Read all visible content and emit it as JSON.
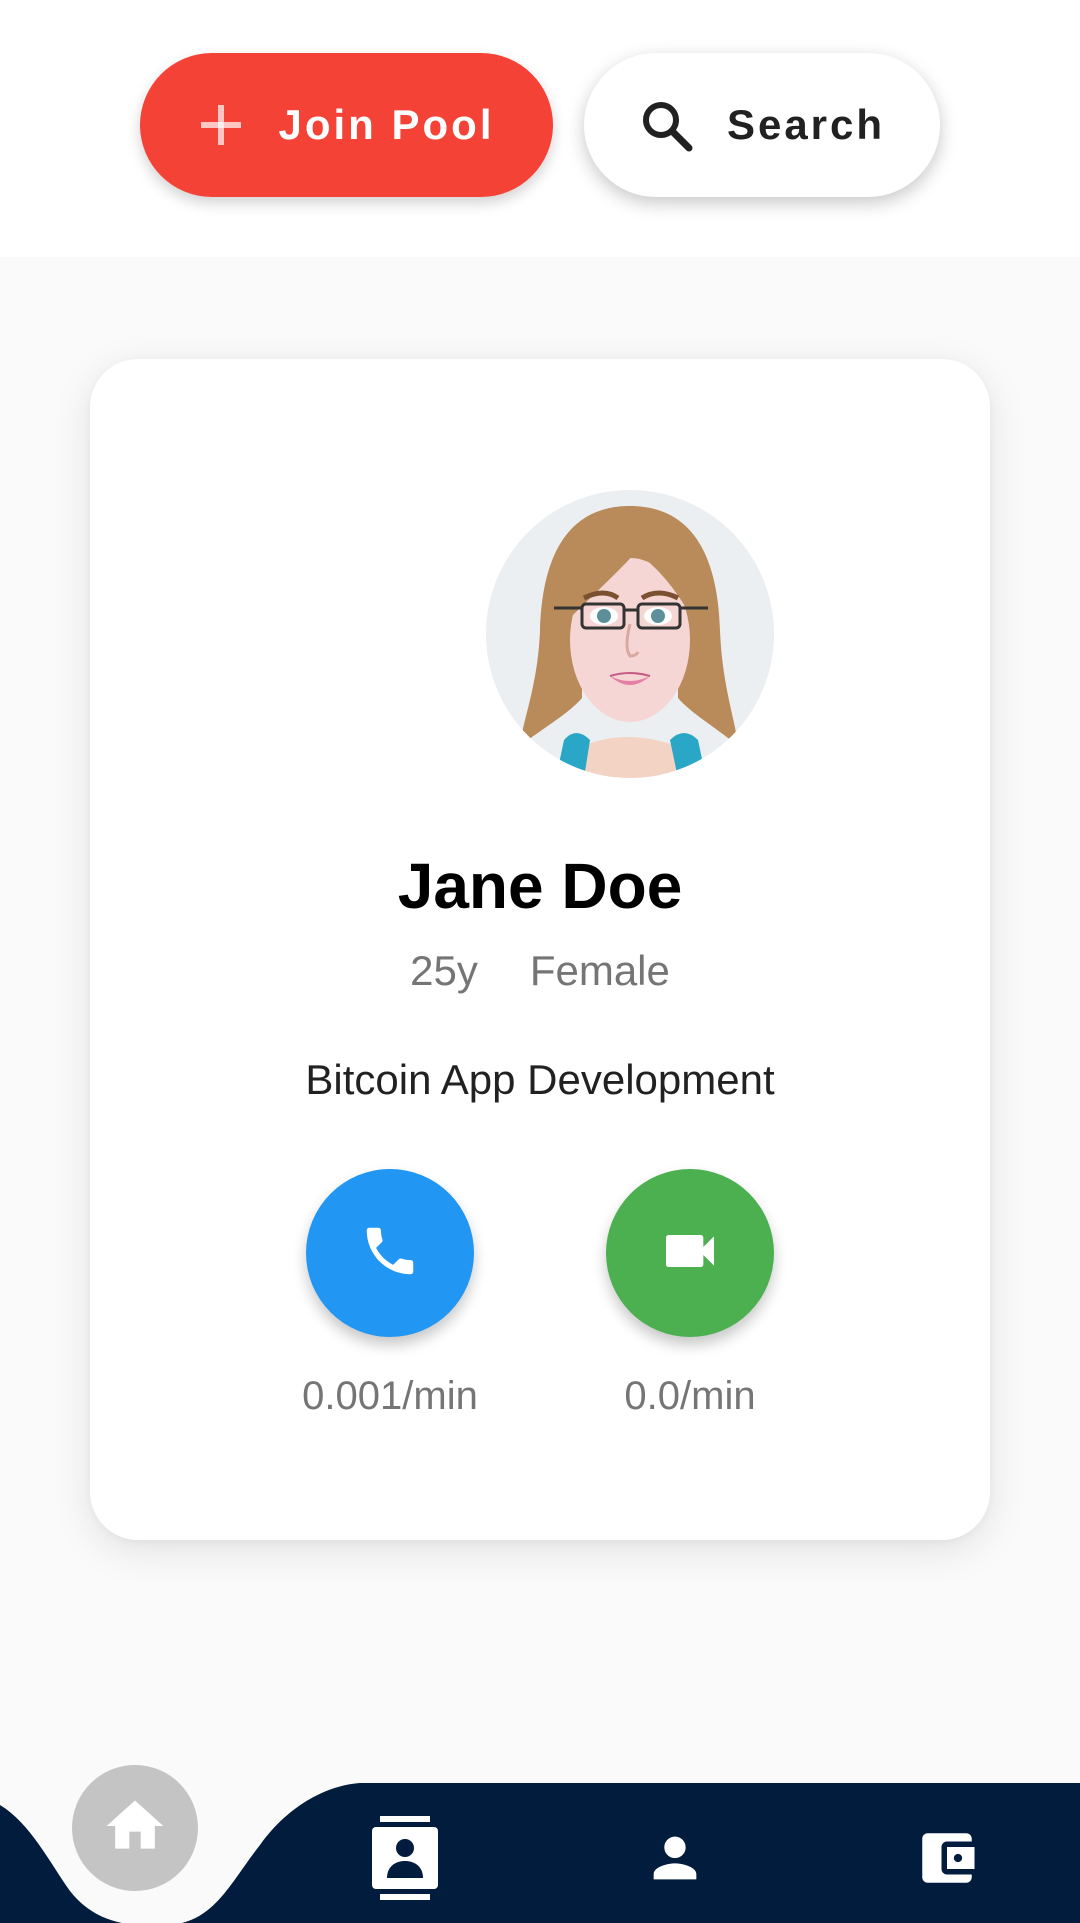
{
  "header": {
    "join_pool_label": "Join Pool",
    "search_label": "Search"
  },
  "profile": {
    "name": "Jane Doe",
    "age": "25y",
    "gender": "Female",
    "topic": "Bitcoin App Development",
    "voice_rate": "0.001/min",
    "video_rate": "0.0/min"
  },
  "colors": {
    "join_button": "#f44336",
    "voice_button": "#2196f3",
    "video_button": "#4caf50",
    "nav_background": "#011c3c",
    "home_button": "#c4c4c4"
  },
  "icons": {
    "join": "plus-icon",
    "search": "search-icon",
    "voice": "phone-icon",
    "video": "video-camera-icon",
    "nav_home": "home-icon",
    "nav_contacts": "contact-card-icon",
    "nav_profile": "person-icon",
    "nav_wallet": "wallet-icon"
  }
}
